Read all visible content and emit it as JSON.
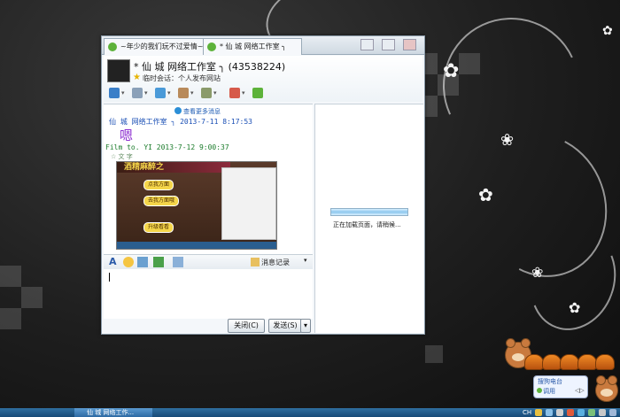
{
  "window": {
    "tabs": [
      {
        "label": "~年少的我们玩不过爱情~"
      },
      {
        "label": "* 仙 城 网络工作室 ╮"
      }
    ],
    "contact": {
      "name": "* 仙 城 网络工作室 ╮ (43538224)",
      "subtitle": "临时会话：个人发布网站"
    },
    "chat": {
      "more_messages": "查看更多消息",
      "messages": [
        {
          "sender": "仙 城 网络工作室 ╮ 2013-7-11 8:17:53",
          "text": "嗯"
        },
        {
          "sender": "Film to. YI 2013-7-12 9:00:37",
          "sub": "☆ 文 字",
          "image_title": "酒精麻醉之",
          "image_buttons": [
            "点我方面",
            "去我方面哦",
            "升级看看"
          ]
        }
      ]
    },
    "format_bar": {
      "history_label": "消息记录"
    },
    "buttons": {
      "close": "关闭(C)",
      "send": "发送(S)"
    },
    "side_panel": {
      "loading_text": "正在加载页面，请稍候..."
    }
  },
  "taskbar": {
    "active_item": "仙 城 网络工作...",
    "tray_lang": "CH"
  },
  "widget": {
    "title": "搜狗电台",
    "play_label": "调用"
  },
  "colors": {
    "desktop_bg": "#1e1e1e",
    "window_bg": "#f4f7fa",
    "accent": "#2c8fd7",
    "message_purple": "#8d2fd0",
    "taskbar": "#174a78"
  }
}
